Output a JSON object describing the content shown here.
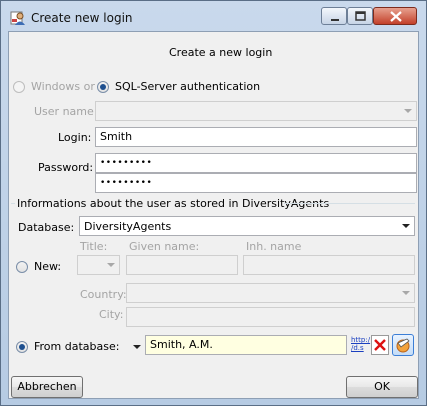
{
  "window": {
    "title": "Create new login"
  },
  "header": {
    "heading": "Create a new login"
  },
  "auth": {
    "windows_label": "Windows or",
    "sql_label": "SQL-Server authentication",
    "selected": "sql"
  },
  "credentials": {
    "username_label": "User name:",
    "username_value": "",
    "login_label": "Login:",
    "login_value": "Smith",
    "password_label": "Password:",
    "password_value": "•••••••••",
    "password_confirm_value": "•••••••••"
  },
  "agents": {
    "section_title": "Informations about the user as stored in DiversityAgents",
    "database_label": "Database:",
    "database_value": "DiversityAgents",
    "new_label": "New:",
    "title_label": "Title:",
    "given_name_label": "Given name:",
    "inh_name_label": "Inh. name",
    "country_label": "Country:",
    "city_label": "City:",
    "from_database_label": "From database:",
    "from_database_value": "Smith, A.M.",
    "selected": "from_database",
    "link_icon_text_1": "http:/",
    "link_icon_text_2": "/d.s"
  },
  "buttons": {
    "cancel": "Abbrechen",
    "ok": "OK"
  },
  "colors": {
    "title_bar": "#b6cbe3",
    "close_button": "#c3402a",
    "from_db_field": "#ffffe1",
    "radio_selected": "#1d4f8f"
  }
}
